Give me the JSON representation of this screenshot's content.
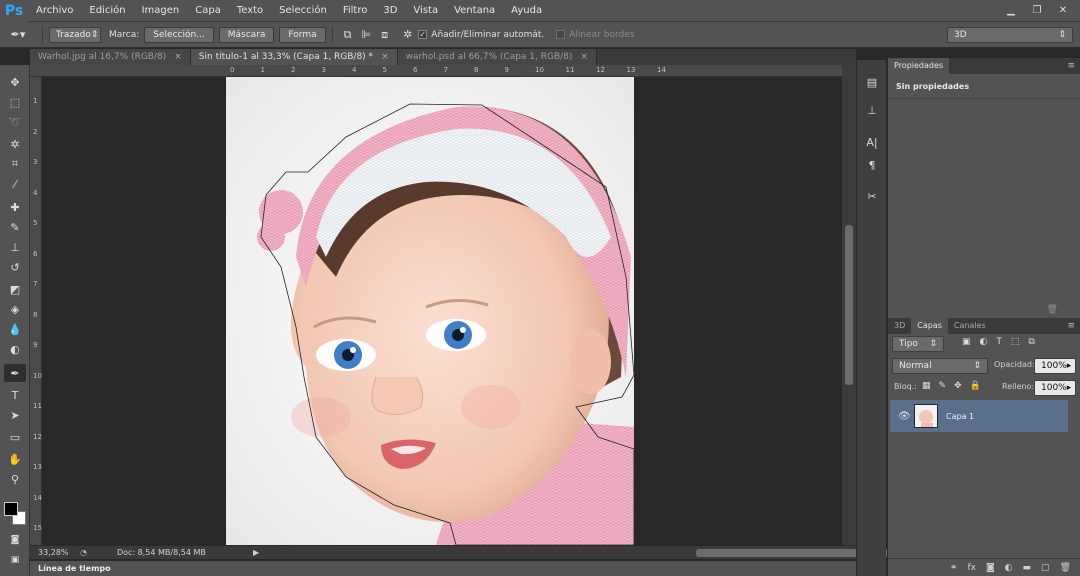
{
  "app": {
    "logo": "Ps"
  },
  "menu": [
    "Archivo",
    "Edición",
    "Imagen",
    "Capa",
    "Texto",
    "Selección",
    "Filtro",
    "3D",
    "Vista",
    "Ventana",
    "Ayuda"
  ],
  "window_controls": [
    "▁",
    "❐",
    "✕"
  ],
  "options": {
    "mode_value": "Trazado",
    "marca_label": "Marca:",
    "seleccion_button": "Selección...",
    "mascara_button": "Máscara",
    "forma_button": "Forma",
    "auto_add_label": "Añadir/Eliminar automát.",
    "align_edges_label": "Alinear bordes",
    "workspace_value": "3D"
  },
  "tabs": [
    {
      "label": "Warhol.jpg al 16,7% (RGB/8)",
      "close": "×"
    },
    {
      "label": "Sin título-1 al 33,3% (Capa 1, RGB/8) *",
      "close": "×"
    },
    {
      "label": "warhol.psd al 66,7% (Capa 1, RGB/8)",
      "close": "×"
    }
  ],
  "ruler_top": [
    "0",
    "1",
    "2",
    "3",
    "4",
    "5",
    "6",
    "7",
    "8",
    "9",
    "10",
    "11",
    "12",
    "13",
    "14"
  ],
  "ruler_left": [
    "1",
    "2",
    "3",
    "4",
    "5",
    "6",
    "7",
    "8",
    "9",
    "10",
    "11",
    "12",
    "13",
    "14",
    "15"
  ],
  "status": {
    "zoom": "33,28%",
    "doc": "Doc: 8,54 MB/8,54 MB"
  },
  "timeline_label": "Línea de tiempo",
  "properties": {
    "tab": "Propiedades",
    "content": "Sin propiedades"
  },
  "layers": {
    "tabs": [
      "3D",
      "Capas",
      "Canales"
    ],
    "filter_value": "Tipo",
    "blend_value": "Normal",
    "opacity_label": "Opacidad:",
    "opacity_value": "100%",
    "lock_label": "Bloq.:",
    "fill_label": "Relleno:",
    "fill_value": "100%",
    "layer_name": "Capa 1"
  },
  "colors": {
    "foreground": "#000000",
    "background": "#ffffff",
    "selected_layer": "#5a6f8c",
    "ps_blue": "#31a8ff"
  }
}
